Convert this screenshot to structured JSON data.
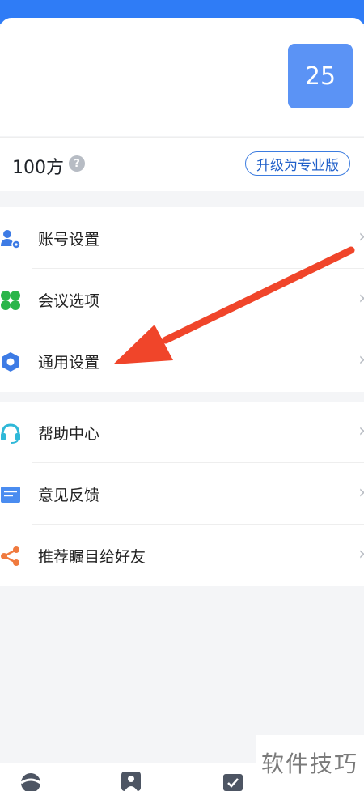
{
  "profile": {
    "badge_number": "25"
  },
  "plan": {
    "capacity": "100方",
    "help_symbol": "?",
    "upgrade_label": "升级为专业版"
  },
  "menu_group_1": [
    {
      "label": "账号设置",
      "icon": "account-settings-icon"
    },
    {
      "label": "会议选项",
      "icon": "meeting-options-icon"
    },
    {
      "label": "通用设置",
      "icon": "general-settings-icon"
    }
  ],
  "menu_group_2": [
    {
      "label": "帮助中心",
      "icon": "headset-icon"
    },
    {
      "label": "意见反馈",
      "icon": "feedback-icon"
    },
    {
      "label": "推荐瞩目给好友",
      "icon": "share-icon"
    }
  ],
  "watermark": "软件技巧",
  "colors": {
    "top_bar": "#2f7cf6",
    "badge": "#5b93f5",
    "arrow": "#f0452a",
    "upgrade": "#1f5fc9"
  }
}
